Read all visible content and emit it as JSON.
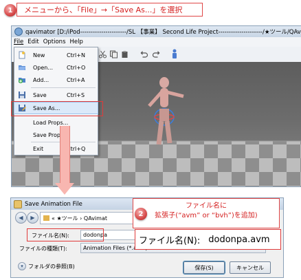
{
  "step1": {
    "number": "1",
    "text": "メニューから、「File」→「Save As...」を選択"
  },
  "step2": {
    "number": "2",
    "line1": "ファイル名に",
    "line2": "拡張子(“avm” or “bvh”)を追加)"
  },
  "main_window": {
    "title": "qavimator [D:/iPod----------------------/SL 【事業】 Second Life Project---------------------/★ツール/QAv",
    "menubar": [
      "File",
      "Edit",
      "Options",
      "Help"
    ],
    "file_menu": [
      {
        "label": "New",
        "shortcut": "Ctrl+N",
        "icon": "new-file-icon"
      },
      {
        "label": "Open...",
        "shortcut": "Ctrl+O",
        "icon": "open-folder-icon"
      },
      {
        "label": "Add...",
        "shortcut": "Ctrl+A",
        "icon": "add-file-icon"
      },
      {
        "label": "Save",
        "shortcut": "Ctrl+S",
        "icon": "save-icon"
      },
      {
        "label": "Save As...",
        "shortcut": "",
        "icon": "save-as-icon"
      },
      {
        "label": "Load Props...",
        "shortcut": "",
        "icon": ""
      },
      {
        "label": "Save Props...",
        "shortcut": "",
        "icon": ""
      },
      {
        "label": "Exit",
        "shortcut": "Ctrl+Q",
        "icon": ""
      }
    ]
  },
  "save_dialog": {
    "title": "Save Animation File",
    "address": "« ★ツール › QAvimat",
    "filename_label": "ファイル名(N):",
    "filename_value": "dodonpa",
    "filetype_label": "ファイルの種類(T):",
    "filetype_value": "Animation Files (*.avm)",
    "browse_folders": "フォルダの参照(B)",
    "save_button": "保存(S)",
    "cancel_button": "キャンセル"
  },
  "zoom": {
    "label": "ファイル名(N):",
    "value": "dodonpa.avm"
  },
  "colors": {
    "callout_red": "#d41f1f",
    "arrow_pink": "#f8b6b0"
  }
}
